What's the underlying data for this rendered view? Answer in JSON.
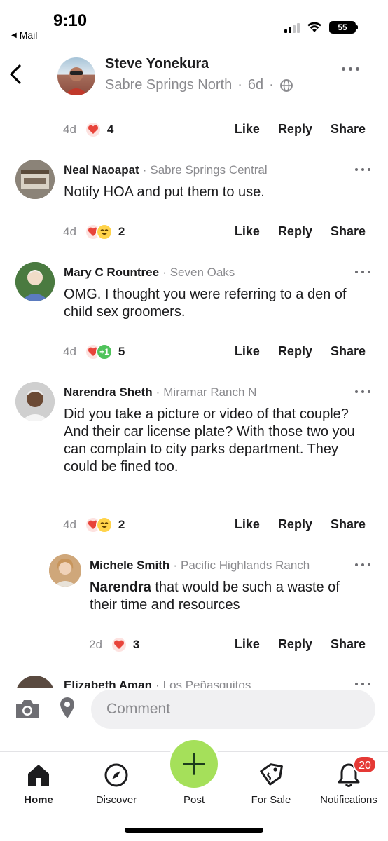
{
  "status_bar": {
    "time": "9:10",
    "back_app": "Mail",
    "battery": "55"
  },
  "post_header": {
    "author": "Steve Yonekura",
    "neighborhood": "Sabre Springs North",
    "age": "6d",
    "separator": "·"
  },
  "top_meta": {
    "time": "4d",
    "reaction_count": "4"
  },
  "actions": {
    "like": "Like",
    "reply": "Reply",
    "share": "Share"
  },
  "comments": [
    {
      "name": "Neal Naoapat",
      "neighborhood": "Sabre Springs Central",
      "text": "Notify HOA and put them to use.",
      "time": "4d",
      "reaction_count": "2",
      "reactions": [
        "heart",
        "laugh"
      ]
    },
    {
      "name": "Mary C Rountree",
      "neighborhood": "Seven Oaks",
      "text": "OMG. I thought you were referring to a den of child sex groomers.",
      "time": "4d",
      "reaction_count": "5",
      "reactions": [
        "heart",
        "plus-one"
      ],
      "plus_one_glyph": "+1"
    },
    {
      "name": "Narendra Sheth",
      "neighborhood": "Miramar Ranch N",
      "text": "Did you take a picture or video of that couple?  And their car license plate?  With those two you can complain to city parks department.  They could be fined too.",
      "time": "4d",
      "reaction_count": "2",
      "reactions": [
        "heart",
        "laugh"
      ]
    }
  ],
  "reply": {
    "name": "Michele Smith",
    "neighborhood": "Pacific Highlands Ranch",
    "mention": "Narendra",
    "text": " that would be such a waste of their time and resources",
    "time": "2d",
    "reaction_count": "3",
    "reactions": [
      "heart"
    ]
  },
  "partial_comment": {
    "name": "Elizabeth Aman",
    "neighborhood": "Los Peñasquitos"
  },
  "comment_bar": {
    "placeholder": "Comment"
  },
  "tabs": [
    {
      "label": "Home",
      "icon": "home-icon",
      "active": true
    },
    {
      "label": "Discover",
      "icon": "compass-icon",
      "active": false
    },
    {
      "label": "Post",
      "icon": "plus-icon",
      "active": false
    },
    {
      "label": "For Sale",
      "icon": "price-tag-icon",
      "active": false
    },
    {
      "label": "Notifications",
      "icon": "bell-icon",
      "active": false
    }
  ],
  "notification_badge": "20",
  "colors": {
    "accent_green": "#a5e05a",
    "badge_red": "#e53935",
    "text_gray": "#8a8a8e"
  }
}
